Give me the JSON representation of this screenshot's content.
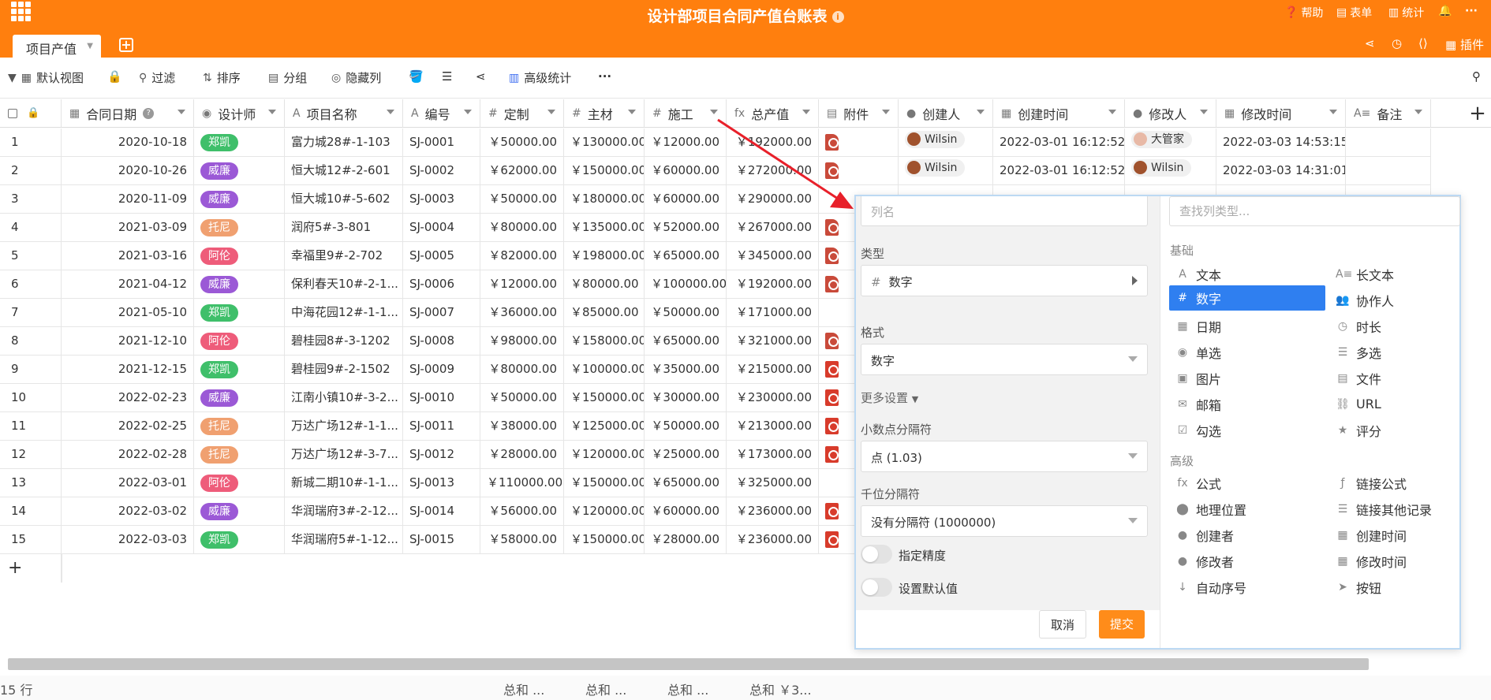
{
  "app": {
    "title": "设计部项目合同产值台账表",
    "info_icon": "info-icon",
    "top_actions": [
      {
        "label": "帮助",
        "icon": "help-icon"
      },
      {
        "label": "表单",
        "icon": "form-icon"
      },
      {
        "label": "统计",
        "icon": "chart-icon"
      }
    ]
  },
  "tabs": {
    "active": "项目产值"
  },
  "toolbar": {
    "view": "默认视图",
    "filter": "过滤",
    "sort": "排序",
    "group": "分组",
    "hide": "隐藏列",
    "stats": "高级统计",
    "more": "···"
  },
  "columns": [
    {
      "label": "合同日期",
      "icon": "calendar-icon"
    },
    {
      "label": "设计师",
      "icon": "single-select-icon"
    },
    {
      "label": "项目名称",
      "icon": "text-icon"
    },
    {
      "label": "编号",
      "icon": "text-icon"
    },
    {
      "label": "定制",
      "icon": "number-icon"
    },
    {
      "label": "主材",
      "icon": "number-icon"
    },
    {
      "label": "施工",
      "icon": "number-icon"
    },
    {
      "label": "总产值",
      "icon": "formula-icon"
    },
    {
      "label": "附件",
      "icon": "file-icon"
    },
    {
      "label": "创建人",
      "icon": "person-icon"
    },
    {
      "label": "创建时间",
      "icon": "calendar-icon"
    },
    {
      "label": "修改人",
      "icon": "person-icon"
    },
    {
      "label": "修改时间",
      "icon": "calendar-icon"
    },
    {
      "label": "备注",
      "icon": "long-text-icon"
    }
  ],
  "rows": [
    {
      "n": "1",
      "date": "2020-10-18",
      "designer": "郑凯",
      "dcolor": "#3fbf6a",
      "name": "富力城28#-1-103",
      "code": "SJ-0001",
      "custom": "￥50000.00",
      "material": "￥130000.00",
      "build": "￥12000.00",
      "total": "￥192000.00",
      "attach": "doc",
      "creator": "Wilsin",
      "ctime": "2022-03-01 16:12:52",
      "modifier": "大管家",
      "mtime": "2022-03-03 14:53:15"
    },
    {
      "n": "2",
      "date": "2020-10-26",
      "designer": "威廉",
      "dcolor": "#9b59d6",
      "name": "恒大城12#-2-601",
      "code": "SJ-0002",
      "custom": "￥62000.00",
      "material": "￥150000.00",
      "build": "￥60000.00",
      "total": "￥272000.00",
      "attach": "doc",
      "creator": "Wilsin",
      "ctime": "2022-03-01 16:12:52",
      "modifier": "Wilsin",
      "mtime": "2022-03-03 14:31:01"
    },
    {
      "n": "3",
      "date": "2020-11-09",
      "designer": "威廉",
      "dcolor": "#9b59d6",
      "name": "恒大城10#-5-602",
      "code": "SJ-0003",
      "custom": "￥50000.00",
      "material": "￥180000.00",
      "build": "￥60000.00",
      "total": "￥290000.00",
      "attach": "",
      "creator": "",
      "ctime": "",
      "modifier": "",
      "mtime": ""
    },
    {
      "n": "4",
      "date": "2021-03-09",
      "designer": "托尼",
      "dcolor": "#f0a070",
      "name": "润府5#-3-801",
      "code": "SJ-0004",
      "custom": "￥80000.00",
      "material": "￥135000.00",
      "build": "￥52000.00",
      "total": "￥267000.00",
      "attach": "doc",
      "creator": "",
      "ctime": "",
      "modifier": "",
      "mtime": ""
    },
    {
      "n": "5",
      "date": "2021-03-16",
      "designer": "阿伦",
      "dcolor": "#ee5c7a",
      "name": "幸福里9#-2-702",
      "code": "SJ-0005",
      "custom": "￥82000.00",
      "material": "￥198000.00",
      "build": "￥65000.00",
      "total": "￥345000.00",
      "attach": "doc",
      "creator": "",
      "ctime": "",
      "modifier": "",
      "mtime": ""
    },
    {
      "n": "6",
      "date": "2021-04-12",
      "designer": "威廉",
      "dcolor": "#9b59d6",
      "name": "保利春天10#-2-1...",
      "code": "SJ-0006",
      "custom": "￥12000.00",
      "material": "￥80000.00",
      "build": "￥100000.00",
      "total": "￥192000.00",
      "attach": "doc",
      "creator": "",
      "ctime": "",
      "modifier": "",
      "mtime": ""
    },
    {
      "n": "7",
      "date": "2021-05-10",
      "designer": "郑凯",
      "dcolor": "#3fbf6a",
      "name": "中海花园12#-1-1...",
      "code": "SJ-0007",
      "custom": "￥36000.00",
      "material": "￥85000.00",
      "build": "￥50000.00",
      "total": "￥171000.00",
      "attach": "",
      "creator": "",
      "ctime": "",
      "modifier": "",
      "mtime": ""
    },
    {
      "n": "8",
      "date": "2021-12-10",
      "designer": "阿伦",
      "dcolor": "#ee5c7a",
      "name": "碧桂园8#-3-1202",
      "code": "SJ-0008",
      "custom": "￥98000.00",
      "material": "￥158000.00",
      "build": "￥65000.00",
      "total": "￥321000.00",
      "attach": "doc",
      "creator": "",
      "ctime": "",
      "modifier": "",
      "mtime": ""
    },
    {
      "n": "9",
      "date": "2021-12-15",
      "designer": "郑凯",
      "dcolor": "#3fbf6a",
      "name": "碧桂园9#-2-1502",
      "code": "SJ-0009",
      "custom": "￥80000.00",
      "material": "￥100000.00",
      "build": "￥35000.00",
      "total": "￥215000.00",
      "attach": "pdf",
      "creator": "",
      "ctime": "",
      "modifier": "",
      "mtime": ""
    },
    {
      "n": "10",
      "date": "2022-02-23",
      "designer": "威廉",
      "dcolor": "#9b59d6",
      "name": "江南小镇10#-3-2...",
      "code": "SJ-0010",
      "custom": "￥50000.00",
      "material": "￥150000.00",
      "build": "￥30000.00",
      "total": "￥230000.00",
      "attach": "pdf",
      "creator": "",
      "ctime": "",
      "modifier": "",
      "mtime": ""
    },
    {
      "n": "11",
      "date": "2022-02-25",
      "designer": "托尼",
      "dcolor": "#f0a070",
      "name": "万达广场12#-1-1...",
      "code": "SJ-0011",
      "custom": "￥38000.00",
      "material": "￥125000.00",
      "build": "￥50000.00",
      "total": "￥213000.00",
      "attach": "pdf",
      "creator": "",
      "ctime": "",
      "modifier": "",
      "mtime": ""
    },
    {
      "n": "12",
      "date": "2022-02-28",
      "designer": "托尼",
      "dcolor": "#f0a070",
      "name": "万达广场12#-3-7...",
      "code": "SJ-0012",
      "custom": "￥28000.00",
      "material": "￥120000.00",
      "build": "￥25000.00",
      "total": "￥173000.00",
      "attach": "pdf",
      "creator": "",
      "ctime": "",
      "modifier": "",
      "mtime": ""
    },
    {
      "n": "13",
      "date": "2022-03-01",
      "designer": "阿伦",
      "dcolor": "#ee5c7a",
      "name": "新城二期10#-1-1...",
      "code": "SJ-0013",
      "custom": "￥110000.00",
      "material": "￥150000.00",
      "build": "￥65000.00",
      "total": "￥325000.00",
      "attach": "",
      "creator": "",
      "ctime": "",
      "modifier": "",
      "mtime": ""
    },
    {
      "n": "14",
      "date": "2022-03-02",
      "designer": "威廉",
      "dcolor": "#9b59d6",
      "name": "华润瑞府3#-2-12...",
      "code": "SJ-0014",
      "custom": "￥56000.00",
      "material": "￥120000.00",
      "build": "￥60000.00",
      "total": "￥236000.00",
      "attach": "pdf",
      "creator": "",
      "ctime": "",
      "modifier": "",
      "mtime": ""
    },
    {
      "n": "15",
      "date": "2022-03-03",
      "designer": "郑凯",
      "dcolor": "#3fbf6a",
      "name": "华润瑞府5#-1-12...",
      "code": "SJ-0015",
      "custom": "￥58000.00",
      "material": "￥150000.00",
      "build": "￥28000.00",
      "total": "￥236000.00",
      "attach": "pdf",
      "creator": "",
      "ctime": "",
      "modifier": "",
      "mtime": ""
    }
  ],
  "footer": {
    "count": "15 行",
    "sums": [
      "总和 ...",
      "总和 ...",
      "总和 ...",
      "总和 ￥3..."
    ]
  },
  "panel": {
    "name_placeholder": "列名",
    "type_label": "类型",
    "type_value": "数字",
    "format_label": "格式",
    "format_value": "数字",
    "more_settings": "更多设置",
    "decimal_label": "小数点分隔符",
    "decimal_value": "点 (1.03)",
    "thousands_label": "千位分隔符",
    "thousands_value": "没有分隔符 (1000000)",
    "precision_label": "指定精度",
    "default_label": "设置默认值",
    "cancel": "取消",
    "submit": "提交",
    "search_placeholder": "查找列类型...",
    "basic_label": "基础",
    "advanced_label": "高级",
    "basic_types": [
      {
        "label": "文本",
        "glyph": "A"
      },
      {
        "label": "长文本",
        "glyph": "A≡"
      },
      {
        "label": "数字",
        "glyph": "#"
      },
      {
        "label": "协作人",
        "glyph": "👥"
      },
      {
        "label": "日期",
        "glyph": "▦"
      },
      {
        "label": "时长",
        "glyph": "◷"
      },
      {
        "label": "单选",
        "glyph": "◉"
      },
      {
        "label": "多选",
        "glyph": "☰"
      },
      {
        "label": "图片",
        "glyph": "▣"
      },
      {
        "label": "文件",
        "glyph": "▤"
      },
      {
        "label": "邮箱",
        "glyph": "✉"
      },
      {
        "label": "URL",
        "glyph": "⛓"
      },
      {
        "label": "勾选",
        "glyph": "☑"
      },
      {
        "label": "评分",
        "glyph": "★"
      }
    ],
    "advanced_types": [
      {
        "label": "公式",
        "glyph": "fx"
      },
      {
        "label": "链接公式",
        "glyph": "ƒ"
      },
      {
        "label": "地理位置",
        "glyph": "⬤"
      },
      {
        "label": "链接其他记录",
        "glyph": "☰"
      },
      {
        "label": "创建者",
        "glyph": "●"
      },
      {
        "label": "创建时间",
        "glyph": "▦"
      },
      {
        "label": "修改者",
        "glyph": "●"
      },
      {
        "label": "修改时间",
        "glyph": "▦"
      },
      {
        "label": "自动序号",
        "glyph": "↓"
      },
      {
        "label": "按钮",
        "glyph": "➤"
      }
    ],
    "accent": "#2f7ff0",
    "submit_color": "#ff8c1a"
  }
}
